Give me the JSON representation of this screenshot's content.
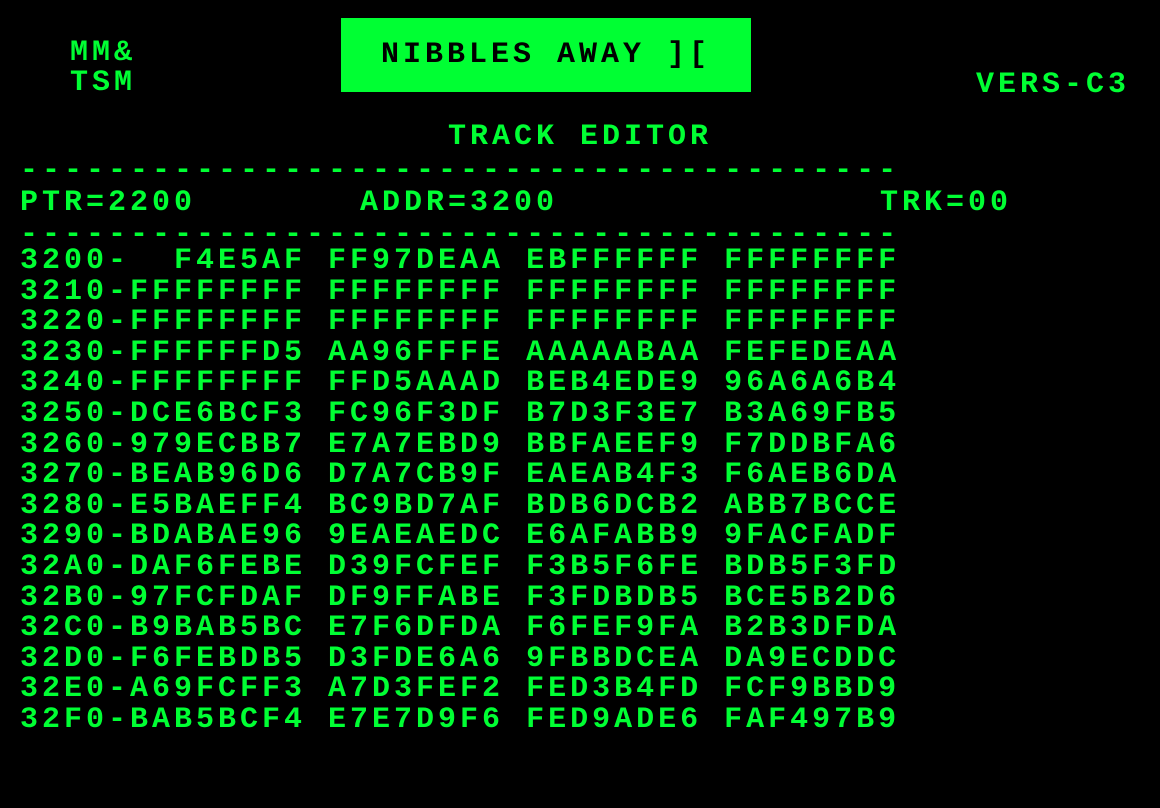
{
  "logo": {
    "line1": "MM&",
    "line2": "TSM"
  },
  "title": "NIBBLES AWAY ][",
  "version": "VERS-C3",
  "subtitle": "TRACK EDITOR",
  "status": {
    "ptr": "PTR=2200",
    "addr": "ADDR=3200",
    "trk": "TRK=00"
  },
  "dashed": "----------------------------------------",
  "hex": {
    "rows": [
      {
        "addr": "3200-",
        "c0": "  F4E5AF",
        "c1": "FF97DEAA",
        "c2": "EBFFFFFF",
        "c3": "FFFFFFFF"
      },
      {
        "addr": "3210-",
        "c0": "FFFFFFFF",
        "c1": "FFFFFFFF",
        "c2": "FFFFFFFF",
        "c3": "FFFFFFFF"
      },
      {
        "addr": "3220-",
        "c0": "FFFFFFFF",
        "c1": "FFFFFFFF",
        "c2": "FFFFFFFF",
        "c3": "FFFFFFFF"
      },
      {
        "addr": "3230-",
        "c0": "FFFFFFD5",
        "c1": "AA96FFFE",
        "c2": "AAAAABAA",
        "c3": "FEFEDEAA"
      },
      {
        "addr": "3240-",
        "c0": "FFFFFFFF",
        "c1": "FFD5AAAD",
        "c2": "BEB4EDE9",
        "c3": "96A6A6B4"
      },
      {
        "addr": "3250-",
        "c0": "DCE6BCF3",
        "c1": "FC96F3DF",
        "c2": "B7D3F3E7",
        "c3": "B3A69FB5"
      },
      {
        "addr": "3260-",
        "c0": "979ECBB7",
        "c1": "E7A7EBD9",
        "c2": "BBFAEEF9",
        "c3": "F7DDBFA6"
      },
      {
        "addr": "3270-",
        "c0": "BEAB96D6",
        "c1": "D7A7CB9F",
        "c2": "EAEAB4F3",
        "c3": "F6AEB6DA"
      },
      {
        "addr": "3280-",
        "c0": "E5BAEFF4",
        "c1": "BC9BD7AF",
        "c2": "BDB6DCB2",
        "c3": "ABB7BCCE"
      },
      {
        "addr": "3290-",
        "c0": "BDABAE96",
        "c1": "9EAEAEDC",
        "c2": "E6AFABB9",
        "c3": "9FACFADF"
      },
      {
        "addr": "32A0-",
        "c0": "DAF6FEBE",
        "c1": "D39FCFEF",
        "c2": "F3B5F6FE",
        "c3": "BDB5F3FD"
      },
      {
        "addr": "32B0-",
        "c0": "97FCFDAF",
        "c1": "DF9FFABE",
        "c2": "F3FDBDB5",
        "c3": "BCE5B2D6"
      },
      {
        "addr": "32C0-",
        "c0": "B9BAB5BC",
        "c1": "E7F6DFDA",
        "c2": "F6FEF9FA",
        "c3": "B2B3DFDA"
      },
      {
        "addr": "32D0-",
        "c0": "F6FEBDB5",
        "c1": "D3FDE6A6",
        "c2": "9FBBDCEA",
        "c3": "DA9ECDDC"
      },
      {
        "addr": "32E0-",
        "c0": "A69FCFF3",
        "c1": "A7D3FEF2",
        "c2": "FED3B4FD",
        "c3": "FCF9BBD9"
      },
      {
        "addr": "32F0-",
        "c0": "BAB5BCF4",
        "c1": "E7E7D9F6",
        "c2": "FED9ADE6",
        "c3": "FAF497B9"
      }
    ]
  }
}
